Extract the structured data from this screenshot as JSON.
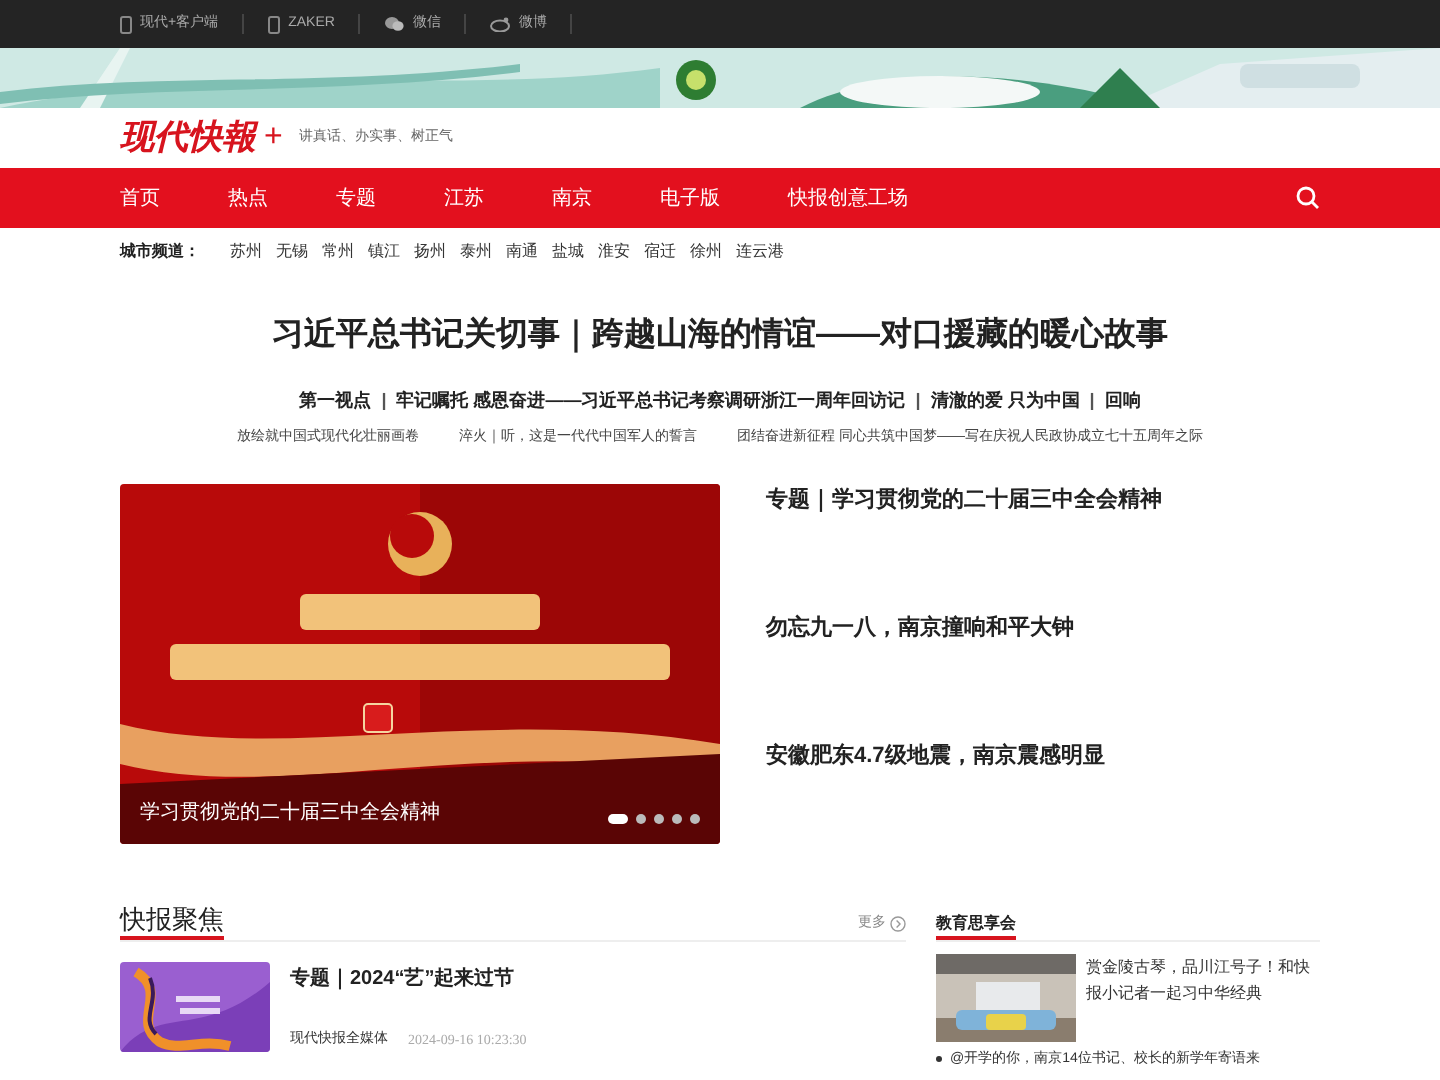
{
  "top_bar": {
    "links": [
      "现代+客户端",
      "ZAKER",
      "微信",
      "微博"
    ]
  },
  "logo": {
    "name": "现代快報",
    "plus": "+",
    "slogan": "讲真话、办实事、树正气"
  },
  "nav": {
    "items": [
      {
        "label": "首页",
        "selected": false
      },
      {
        "label": "热点",
        "selected": false
      },
      {
        "label": "专题",
        "selected": false
      },
      {
        "label": "江苏",
        "selected": false
      },
      {
        "label": "南京",
        "selected": false
      },
      {
        "label": "电子版",
        "selected": false
      },
      {
        "label": "快报创意工场",
        "selected": false
      }
    ]
  },
  "city_channels": {
    "label": "城市频道：",
    "cities": [
      "苏州",
      "无锡",
      "常州",
      "镇江",
      "扬州",
      "泰州",
      "南通",
      "盐城",
      "淮安",
      "宿迁",
      "徐州",
      "连云港"
    ]
  },
  "headline": "习近平总书记关切事｜跨越山海的情谊——对口援藏的暖心故事",
  "sub_headlines": [
    {
      "kind": "link",
      "text": "第一视点"
    },
    {
      "kind": "separator",
      "text": "|"
    },
    {
      "kind": "link",
      "text": "牢记嘱托 感恩奋进——习近平总书记考察调研浙江一周年回访记"
    },
    {
      "kind": "separator",
      "text": "|"
    },
    {
      "kind": "link",
      "text": "清澈的爱 只为中国"
    },
    {
      "kind": "separator",
      "text": "|"
    },
    {
      "kind": "link",
      "text": "回响"
    }
  ],
  "small_links": [
    "放绘就中国式现代化壮丽画卷",
    "淬火｜听，这是一代代中国军人的誓言",
    "团结奋进新征程 同心共筑中国梦——写在庆祝人民政协成立七十五周年之际"
  ],
  "slider": {
    "caption": "学习贯彻党的二十届三中全会精神",
    "dots": [
      {
        "selected": true
      },
      {
        "selected": false
      },
      {
        "selected": false
      },
      {
        "selected": false
      },
      {
        "selected": false
      }
    ]
  },
  "top_stories": [
    "专题｜学习贯彻党的二十届三中全会精神",
    "勿忘九一八，南京撞响和平大钟",
    "安徽肥东4.7级地震，南京震感明显"
  ],
  "focus": {
    "title": "快报聚焦",
    "more": "更多",
    "articles": [
      {
        "title": "专题｜2024“艺”起来过节",
        "source": "现代快报全媒体",
        "time": "2024-09-16 10:23:30"
      }
    ]
  },
  "education": {
    "title": "教育思享会",
    "feature": "赏金陵古琴，品川江号子！和快报小记者一起习中华经典",
    "items": [
      "@开学的你，南京14位书记、校长的新学年寄语来"
    ]
  }
}
